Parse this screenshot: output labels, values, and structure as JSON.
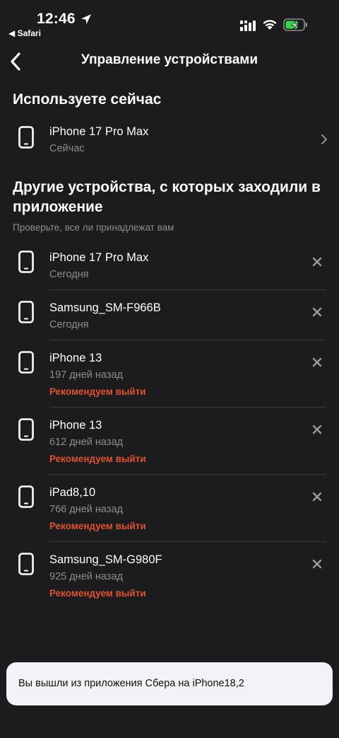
{
  "status_bar": {
    "time": "12:46",
    "back_app": "◀ Safari"
  },
  "header": {
    "title": "Управление устройствами"
  },
  "current_section": {
    "title": "Используете сейчас",
    "device": {
      "name": "iPhone 17 Pro Max",
      "time": "Сейчас"
    }
  },
  "other_section": {
    "title": "Другие устройства, с которых заходили в приложение",
    "hint": "Проверьте, все ли принадлежат вам",
    "devices": [
      {
        "name": "iPhone 17 Pro Max",
        "time": "Сегодня",
        "warning": ""
      },
      {
        "name": "Samsung_SM-F966B",
        "time": "Сегодня",
        "warning": ""
      },
      {
        "name": "iPhone 13",
        "time": "197 дней назад",
        "warning": "Рекомендуем выйти"
      },
      {
        "name": "iPhone 13",
        "time": "612 дней назад",
        "warning": "Рекомендуем выйти"
      },
      {
        "name": "iPad8,10",
        "time": "766 дней назад",
        "warning": "Рекомендуем выйти"
      },
      {
        "name": "Samsung_SM-G980F",
        "time": "925 дней назад",
        "warning": "Рекомендуем выйти"
      }
    ]
  },
  "toast": {
    "text": "Вы вышли из приложения Сбера на iPhone18,2"
  },
  "colors": {
    "background": "#1c1c1e",
    "warning": "#e0522f",
    "secondary_text": "#8d8d92",
    "battery_charging": "#32d74b"
  },
  "icons": {
    "back": "chevron-left-icon",
    "device": "smartphone-icon",
    "remove": "close-icon",
    "open": "chevron-right-icon"
  }
}
